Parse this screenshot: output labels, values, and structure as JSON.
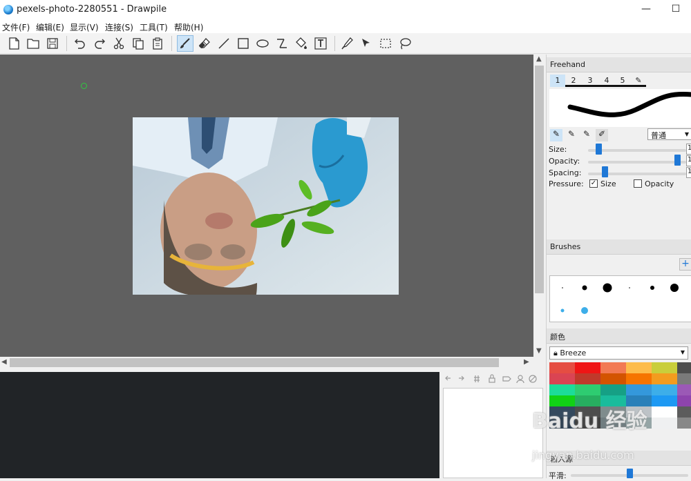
{
  "window": {
    "title": "pexels-photo-2280551 - Drawpile",
    "minimize_glyph": "—",
    "maximize_glyph": "☐"
  },
  "menu": [
    "文件(F)",
    "编辑(E)",
    "显示(V)",
    "连接(S)",
    "工具(T)",
    "帮助(H)"
  ],
  "toolbar": {
    "icons": [
      "new-file-icon",
      "open-file-icon",
      "save-icon",
      "undo-icon",
      "redo-icon",
      "cut-icon",
      "copy-icon",
      "paste-icon",
      "brush-icon",
      "eraser-icon",
      "line-icon",
      "rectangle-icon",
      "ellipse-icon",
      "bezier-icon",
      "fill-icon",
      "text-icon",
      "color-picker-icon",
      "laser-pointer-icon",
      "rect-select-icon",
      "lasso-select-icon"
    ],
    "active_tool": "brush-icon"
  },
  "tool_settings": {
    "title": "Freehand",
    "slots": [
      "1",
      "2",
      "3",
      "4",
      "5"
    ],
    "active_slot": "1",
    "blend_mode": "普通",
    "size_label": "Size:",
    "size_value": "1",
    "opacity_label": "Opacity:",
    "opacity_value": "1",
    "spacing_label": "Spacing:",
    "spacing_value": "1",
    "pressure_label": "Pressure:",
    "pressure_size_label": "Size",
    "pressure_size_checked": true,
    "pressure_opacity_label": "Opacity",
    "pressure_opacity_checked": false,
    "size_level": 0.08,
    "opacity_level": 1.0,
    "spacing_level": 0.15
  },
  "brushes": {
    "title": "Brushes",
    "add_button": "+"
  },
  "color": {
    "title": "颜色",
    "palette_name": "Breeze",
    "swatches": [
      [
        "#e54d42",
        "#ef1515",
        "#f27a53",
        "#fdbc4b",
        "#c9ce3b",
        "#4d4d4d"
      ],
      [
        "#da4453",
        "#c0392b",
        "#d35400",
        "#f67400",
        "#f39c1f",
        "#7a7a7a"
      ],
      [
        "#1cdc9a",
        "#2ecc71",
        "#16a085",
        "#3498db",
        "#3daee9",
        "#9b59b6"
      ],
      [
        "#11d116",
        "#27ae60",
        "#1abc9c",
        "#2980b9",
        "#1d99f3",
        "#8e44ad"
      ],
      [
        "#34495e",
        "#4d4d4d",
        "#7f8c8d",
        "#bdc3c7",
        "#ffffff",
        "#5c5c5c"
      ],
      [
        "#2c3e50",
        "#3f3f3f",
        "#707d80",
        "#95a5a6",
        "#eff0f1",
        "#888888"
      ]
    ]
  },
  "input_panel": {
    "title": "输入源",
    "smoothing_label": "平滑:",
    "smoothing_level": 0.5
  },
  "watermark": {
    "brand": "Baidu 经验",
    "url": "jingyan.baidu.com"
  }
}
